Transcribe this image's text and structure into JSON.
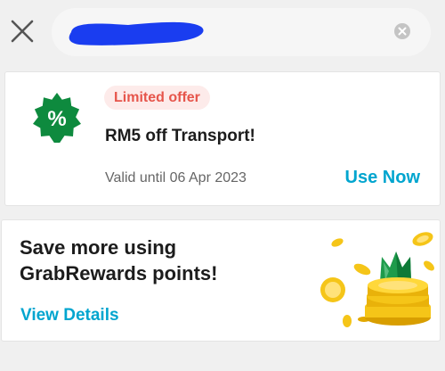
{
  "topbar": {
    "search": {
      "value": "",
      "placeholder": ""
    }
  },
  "voucher": {
    "tag": "Limited offer",
    "title": "RM5 off Transport!",
    "valid_text": "Valid until 06 Apr 2023",
    "action": "Use Now",
    "badge_symbol": "%"
  },
  "rewards": {
    "headline_line1": "Save more using",
    "headline_line2": "GrabRewards points!",
    "action": "View Details"
  },
  "colors": {
    "accent": "#00a5cf",
    "badge_green": "#0e8a3e",
    "offer_tag_bg": "#fdebea",
    "offer_tag_text": "#e6554b",
    "redaction_blue": "#1a3df0",
    "coin_gold": "#f5c518"
  },
  "icons": [
    "close-icon",
    "clear-icon",
    "discount-badge-icon",
    "coins-illustration"
  ]
}
